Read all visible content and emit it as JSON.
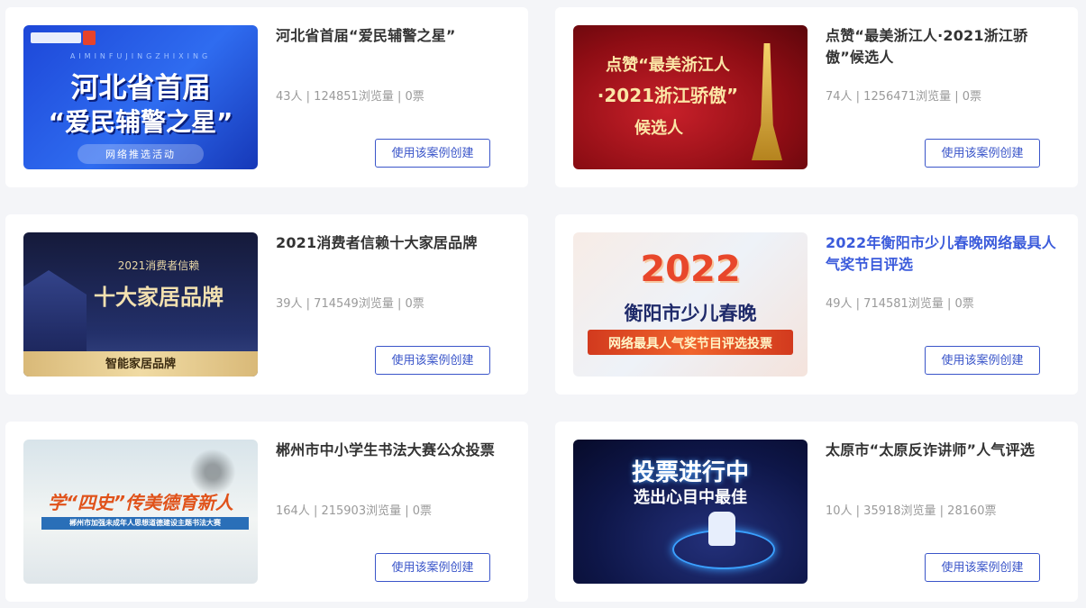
{
  "cards": [
    {
      "title": "河北省首届“爱民辅警之星”",
      "stats": "43人 | 124851浏览量 | 0票",
      "button": "使用该案例创建",
      "thumb": {
        "line1": "河北省首届",
        "line2": "“爱民辅警之星”",
        "line3": "网络推选活动",
        "letters": "AIMINFUJINGZHIXING"
      }
    },
    {
      "title": "点赞“最美浙江人·2021浙江骄傲”候选人",
      "stats": "74人 | 1256471浏览量 | 0票",
      "button": "使用该案例创建",
      "thumb": {
        "line1": "点赞“最美浙江人",
        "line2": "·2021浙江骄傲”",
        "line3": "候选人"
      }
    },
    {
      "title": "2021消费者信赖十大家居品牌",
      "stats": "39人 | 714549浏览量 | 0票",
      "button": "使用该案例创建",
      "thumb": {
        "line1": "2021消费者信赖",
        "line2": "十大家居品牌",
        "line3": "智能家居品牌"
      }
    },
    {
      "title": "2022年衡阳市少儿春晚网络最具人气奖节目评选",
      "stats": "49人 | 714581浏览量 | 0票",
      "button": "使用该案例创建",
      "thumb": {
        "line1": "2022",
        "line2": "衡阳市少儿春晚",
        "line3": "网络最具人气奖节目评选投票"
      }
    },
    {
      "title": "郴州市中小学生书法大赛公众投票",
      "stats": "164人 | 215903浏览量 | 0票",
      "button": "使用该案例创建",
      "thumb": {
        "line1": "学“四史”传美德育新人",
        "line2": "郴州市加强未成年人思想道德建设主题书法大赛"
      }
    },
    {
      "title": "太原市“太原反诈讲师”人气评选",
      "stats": "10人 | 35918浏览量 | 28160票",
      "button": "使用该案例创建",
      "thumb": {
        "line1": "投票进行中",
        "line2": "选出心目中最佳"
      }
    }
  ]
}
